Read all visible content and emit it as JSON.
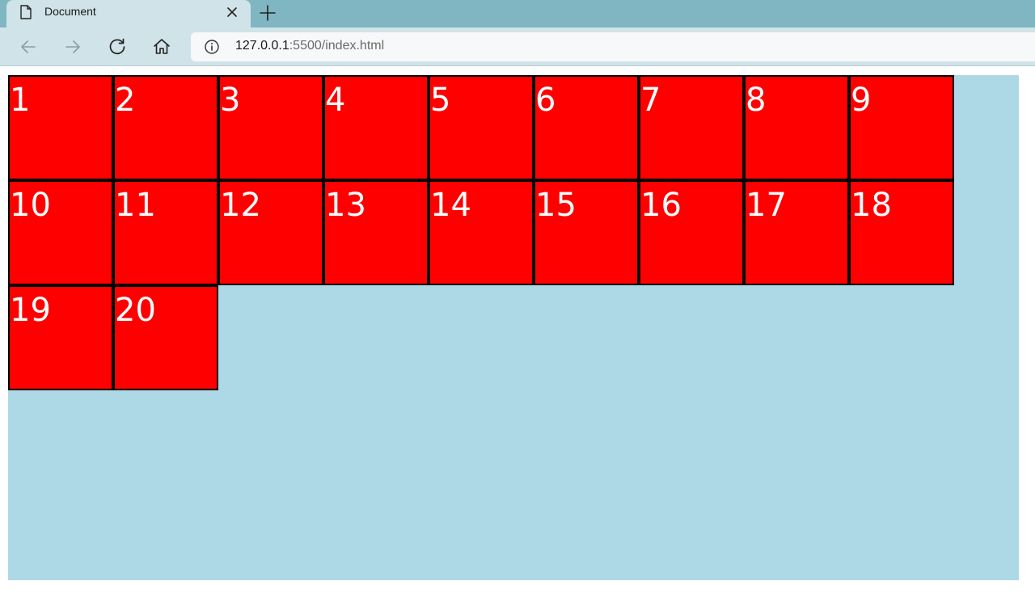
{
  "browser": {
    "tab": {
      "title": "Document",
      "icons": {
        "page": "document-icon",
        "close": "close-icon"
      }
    },
    "new_tab_icon": "plus-icon",
    "nav": {
      "back_icon": "arrow-left-icon",
      "forward_icon": "arrow-right-icon",
      "reload_icon": "reload-icon",
      "home_icon": "home-icon"
    },
    "address": {
      "info_icon": "info-icon",
      "url_host": "127.0.0.1",
      "url_rest": ":5500/index.html"
    }
  },
  "page": {
    "container_color": "#add8e6",
    "box_color": "#ff0000",
    "box_border": "#000000",
    "box_text_color": "#ffffff",
    "boxes": [
      "1",
      "2",
      "3",
      "4",
      "5",
      "6",
      "7",
      "8",
      "9",
      "10",
      "11",
      "12",
      "13",
      "14",
      "15",
      "16",
      "17",
      "18",
      "19",
      "20"
    ]
  }
}
